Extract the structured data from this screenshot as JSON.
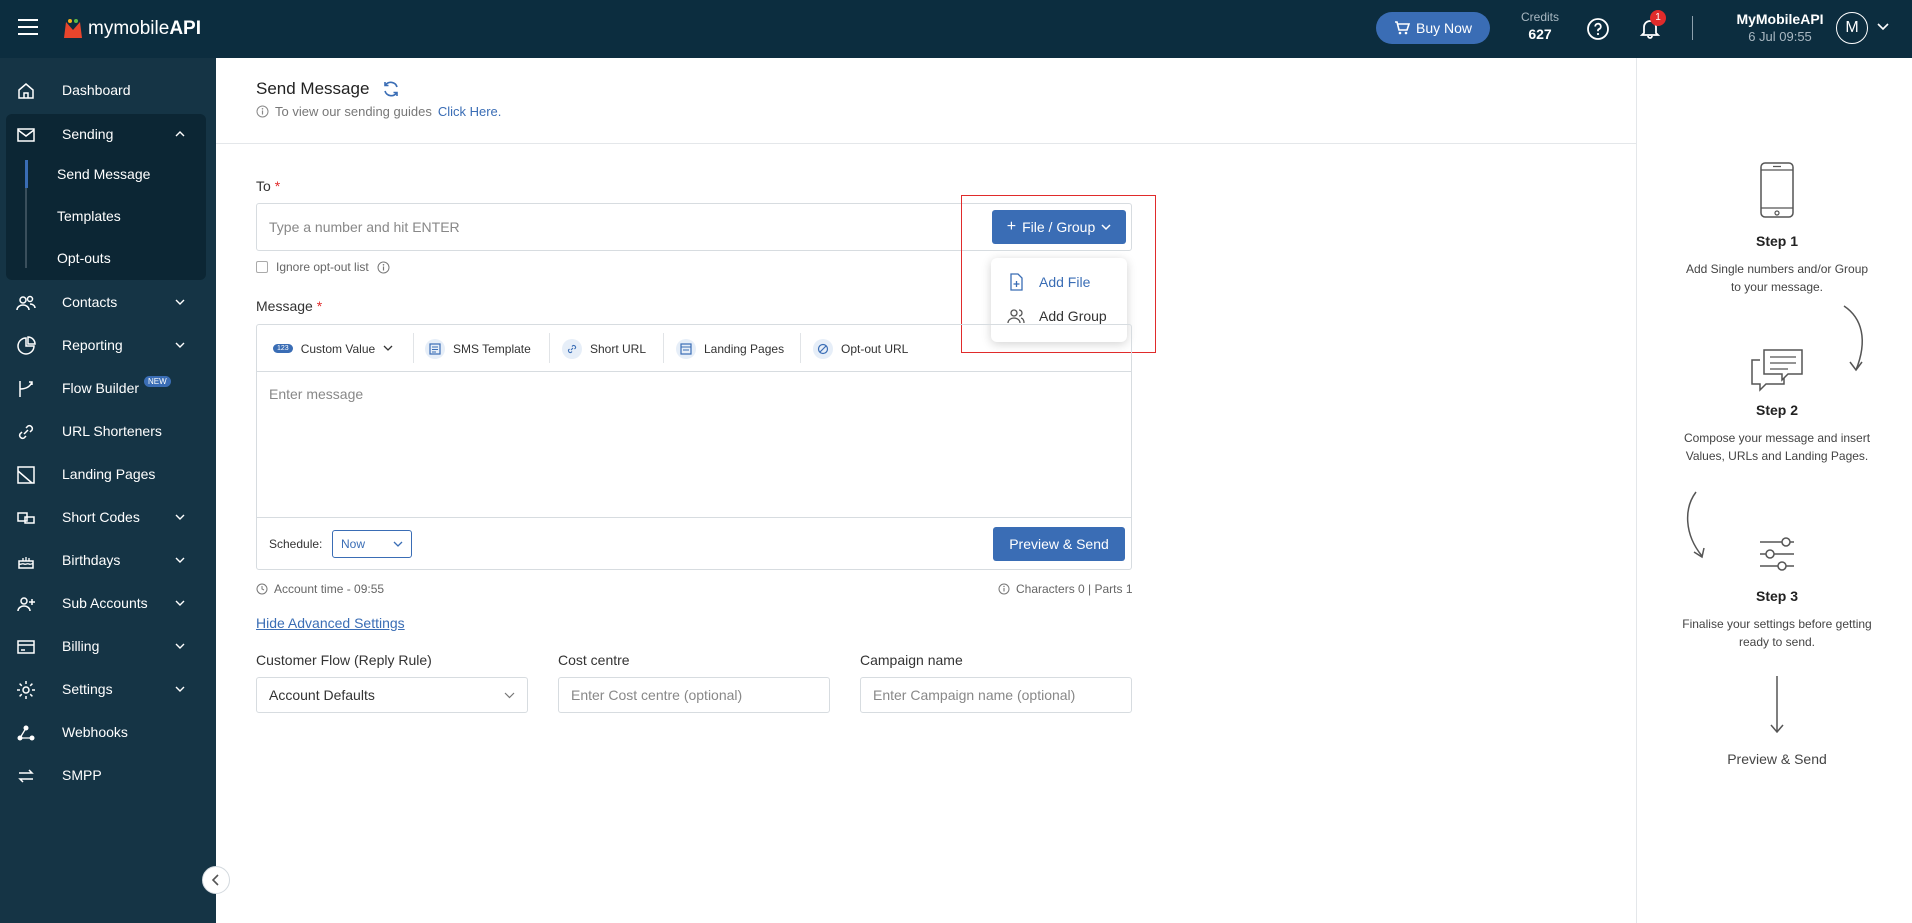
{
  "topbar": {
    "logo_text_plain": "mymobile",
    "logo_text_bold": "API",
    "buy_now_label": "Buy Now",
    "credits_label": "Credits",
    "credits_value": "627",
    "notification_count": "1",
    "account_name": "MyMobileAPI",
    "account_datetime": "6 Jul 09:55",
    "avatar_initial": "M"
  },
  "sidebar": {
    "dashboard": "Dashboard",
    "sending": "Sending",
    "send_message": "Send Message",
    "templates": "Templates",
    "opt_outs": "Opt-outs",
    "contacts": "Contacts",
    "reporting": "Reporting",
    "flow_builder": "Flow Builder",
    "new_badge": "NEW",
    "url_shorteners": "URL Shorteners",
    "landing_pages": "Landing Pages",
    "short_codes": "Short Codes",
    "birthdays": "Birthdays",
    "sub_accounts": "Sub Accounts",
    "billing": "Billing",
    "settings": "Settings",
    "webhooks": "Webhooks",
    "smpp": "SMPP"
  },
  "main": {
    "title": "Send Message",
    "guide_text": "To view our sending guides",
    "guide_link": "Click Here.",
    "to_label": "To",
    "required_mark": "*",
    "to_placeholder": "Type a number and hit ENTER",
    "file_group_label": "File / Group",
    "add_file": "Add File",
    "add_group": "Add Group",
    "ignore_optout": "Ignore opt-out list",
    "message_label": "Message",
    "toolbar": {
      "custom_value": "Custom Value",
      "custom_value_badge": "123",
      "sms_template": "SMS Template",
      "short_url": "Short URL",
      "landing_pages": "Landing Pages",
      "optout_url": "Opt-out URL"
    },
    "message_placeholder": "Enter message",
    "schedule_label": "Schedule:",
    "schedule_value": "Now",
    "preview_send": "Preview & Send",
    "account_time": "Account time - 09:55",
    "characters": "Characters 0 | Parts 1",
    "hide_advanced": "Hide Advanced Settings",
    "customer_flow_label": "Customer Flow (Reply Rule)",
    "customer_flow_value": "Account Defaults",
    "cost_centre_label": "Cost centre",
    "cost_centre_placeholder": "Enter Cost centre (optional)",
    "campaign_label": "Campaign name",
    "campaign_placeholder": "Enter Campaign name (optional)"
  },
  "steps": {
    "step1_title": "Step 1",
    "step1_desc": "Add Single numbers and/or Group to your message.",
    "step2_title": "Step 2",
    "step2_desc": "Compose your message and insert Values, URLs and Landing Pages.",
    "step3_title": "Step 3",
    "step3_desc": "Finalise your settings before getting ready to send.",
    "final": "Preview & Send"
  },
  "colors": {
    "topbar": "#0c2d3f",
    "sidebar": "#153445",
    "accent": "#3a6db5",
    "badge": "#e02b2b"
  }
}
